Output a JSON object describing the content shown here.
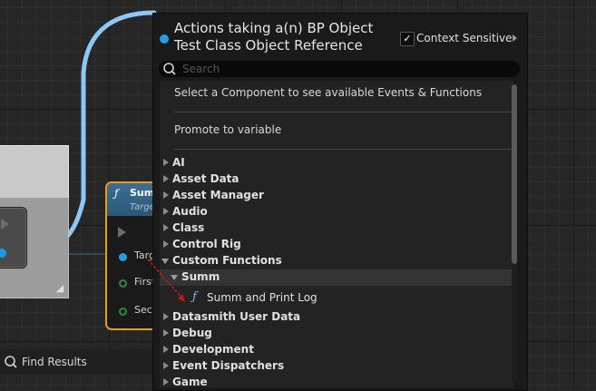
{
  "graph": {
    "function_node": {
      "title": "Summ",
      "subtitle": "Target",
      "pins": [
        "Target",
        "First",
        "Second"
      ]
    },
    "find_results": {
      "label": "Find Results"
    }
  },
  "menu": {
    "title": "Actions taking a(n) BP Object Test Class Object Reference",
    "context_sensitive": {
      "label": "Context Sensitive",
      "checked": true
    },
    "search": {
      "placeholder": "Search",
      "value": ""
    },
    "info_text": "Select a Component to see available Events & Functions",
    "promote": "Promote to variable",
    "categories": [
      {
        "label": "AI",
        "expanded": false
      },
      {
        "label": "Asset Data",
        "expanded": false
      },
      {
        "label": "Asset Manager",
        "expanded": false
      },
      {
        "label": "Audio",
        "expanded": false
      },
      {
        "label": "Class",
        "expanded": false
      },
      {
        "label": "Control Rig",
        "expanded": false
      },
      {
        "label": "Custom Functions",
        "expanded": true
      },
      {
        "label": "Summ",
        "expanded": true
      },
      {
        "label": "Summ and Print Log",
        "expanded": false
      },
      {
        "label": "Datasmith User Data",
        "expanded": false
      },
      {
        "label": "Debug",
        "expanded": false
      },
      {
        "label": "Development",
        "expanded": false
      },
      {
        "label": "Event Dispatchers",
        "expanded": false
      },
      {
        "label": "Game",
        "expanded": false
      }
    ]
  },
  "colors": {
    "accent_blue": "#1da0ea",
    "node_border": "#e89d16",
    "wire": "#8cc8f5",
    "annotation_red": "#d01515"
  }
}
